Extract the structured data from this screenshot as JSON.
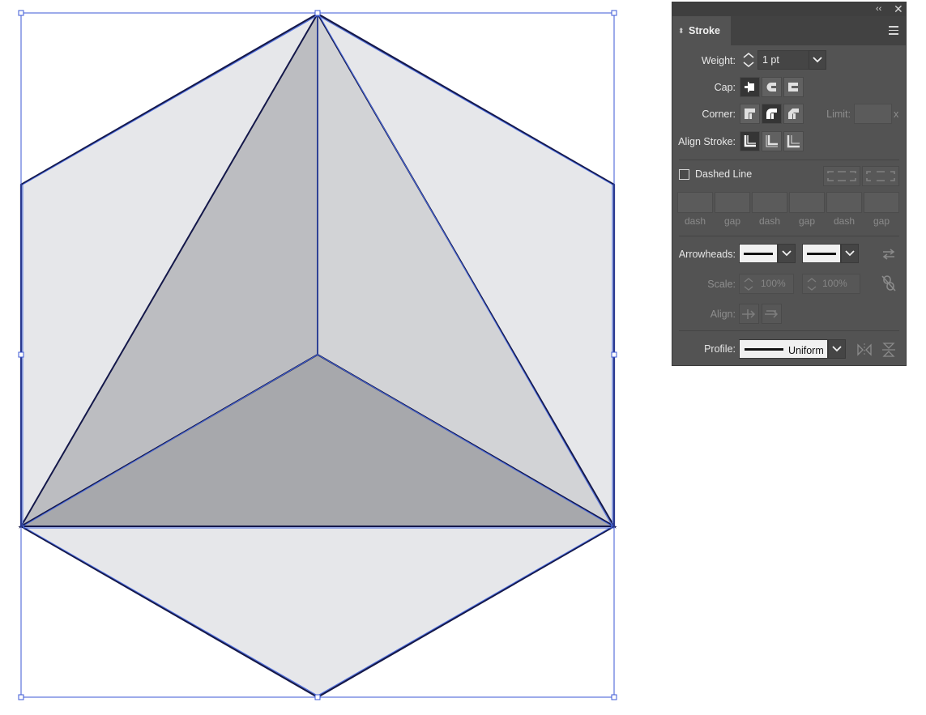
{
  "panel": {
    "title": "Stroke",
    "weight": {
      "label": "Weight:",
      "value": "1 pt"
    },
    "cap": {
      "label": "Cap:"
    },
    "corner": {
      "label": "Corner:",
      "limit_label": "Limit:",
      "limit_suffix": "x"
    },
    "align_stroke": {
      "label": "Align Stroke:"
    },
    "dashed_line": {
      "label": "Dashed Line",
      "checked": false
    },
    "dash_labels": [
      "dash",
      "gap",
      "dash",
      "gap",
      "dash",
      "gap"
    ],
    "arrowheads": {
      "label": "Arrowheads:"
    },
    "scale": {
      "label": "Scale:",
      "start": "100%",
      "end": "100%"
    },
    "align": {
      "label": "Align:"
    },
    "profile": {
      "label": "Profile:",
      "value": "Uniform"
    }
  },
  "colors": {
    "panel_bg": "#535353",
    "selection_blue": "#3b57d6",
    "stroke_navy": "#14184a",
    "face_light": "#e6e7ea",
    "face_left": "#bcbdc1",
    "face_right": "#d2d3d6",
    "face_bottom": "#a7a8ac"
  }
}
